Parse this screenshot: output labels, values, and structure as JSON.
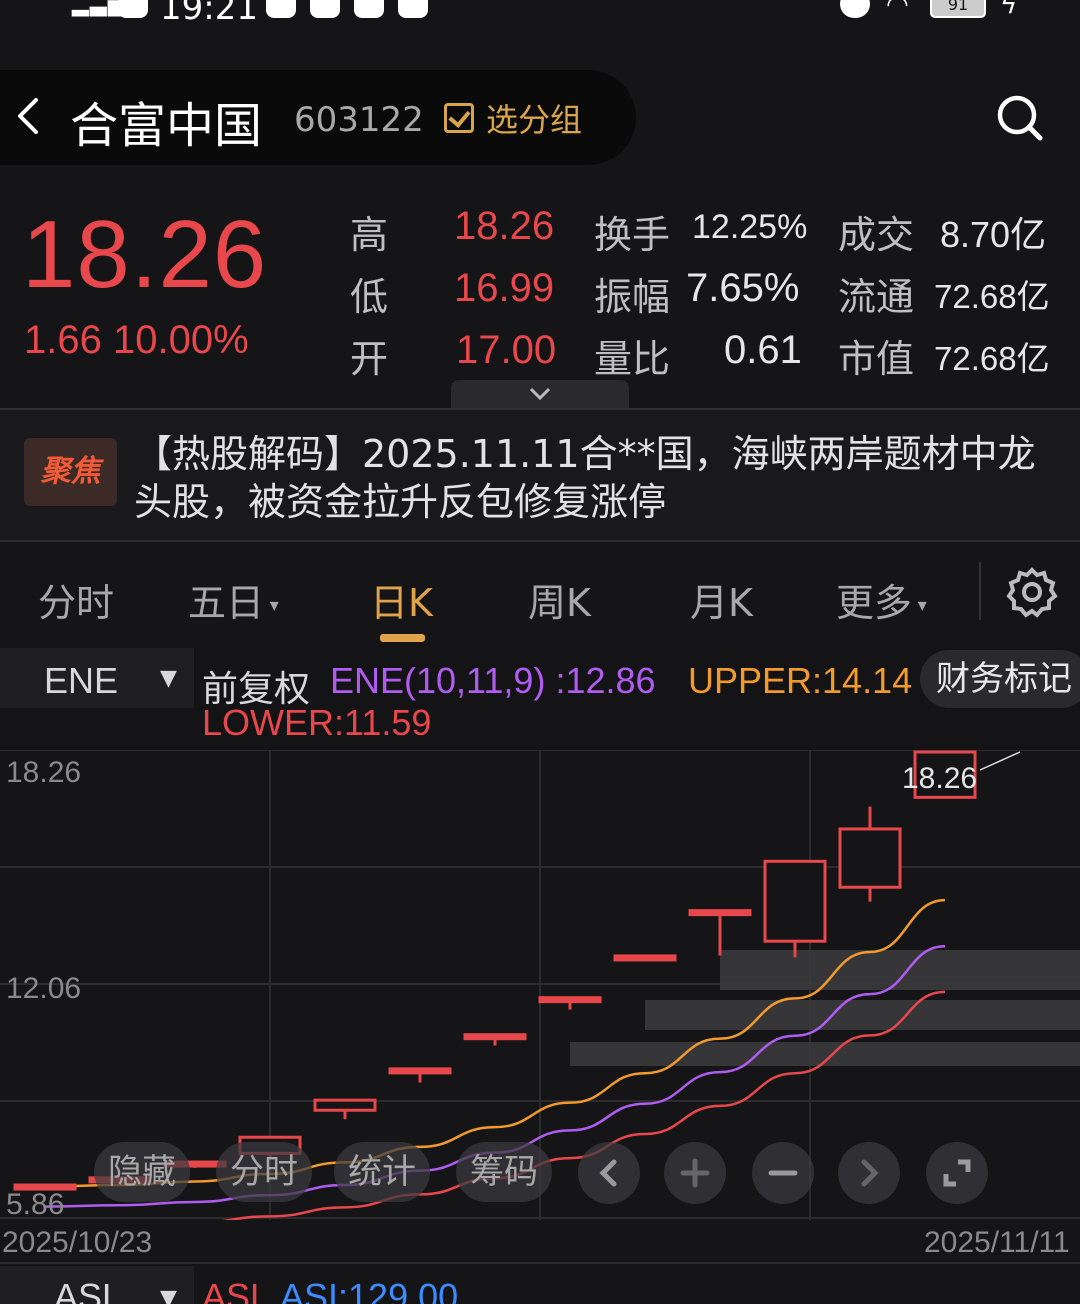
{
  "status_bar": {
    "time": "19:21",
    "battery": "91"
  },
  "header": {
    "title": "合富中国",
    "code": "603122",
    "group_button": "选分组"
  },
  "quote": {
    "price": "18.26",
    "change": "1.66 10.00%",
    "rows": [
      {
        "l1": "高",
        "v1": "18.26",
        "l2": "换手",
        "v2": "12.25%",
        "l3": "成交",
        "v3": "8.70亿"
      },
      {
        "l1": "低",
        "v1": "16.99",
        "l2": "振幅",
        "v2": "7.65%",
        "l3": "流通",
        "v3": "72.68亿"
      },
      {
        "l1": "开",
        "v1": "17.00",
        "l2": "量比",
        "v2": "0.61",
        "l3": "市值",
        "v3": "72.68亿"
      }
    ]
  },
  "news": {
    "badge": "聚焦",
    "text": "【热股解码】2025.11.11合**国，海峡两岸题材中龙头股，被资金拉升反包修复涨停"
  },
  "tabs": [
    "分时",
    "五日",
    "日K",
    "周K",
    "月K",
    "更多"
  ],
  "active_tab": "日K",
  "indicator": {
    "selector": "ENE",
    "fuquan": "前复权",
    "ene": "ENE(10,11,9)  :12.86",
    "upper": "UPPER:14.14",
    "lower": "LOWER:11.59",
    "finance_button": "财务标记"
  },
  "chart_data": {
    "type": "candlestick",
    "y_ticks": [
      "18.26",
      "12.06",
      "5.86"
    ],
    "x_labels": [
      "2025/10/23",
      "2025/11/11"
    ],
    "high_label": "18.26",
    "candles": [
      {
        "open": 6.2,
        "close": 6.22,
        "high": 6.24,
        "low": 6.18
      },
      {
        "open": 6.4,
        "close": 6.42,
        "high": 6.44,
        "low": 6.36
      },
      {
        "open": 6.84,
        "close": 6.86,
        "high": 6.9,
        "low": 6.7
      },
      {
        "open": 7.1,
        "close": 7.55,
        "high": 7.55,
        "low": 6.95
      },
      {
        "open": 8.3,
        "close": 8.58,
        "high": 8.58,
        "low": 8.05
      },
      {
        "open": 9.43,
        "close": 9.45,
        "high": 9.45,
        "low": 9.07
      },
      {
        "open": 10.38,
        "close": 10.4,
        "high": 10.4,
        "low": 10.1
      },
      {
        "open": 11.41,
        "close": 11.43,
        "high": 11.43,
        "low": 11.1
      },
      {
        "open": 12.57,
        "close": 12.59,
        "high": 12.59,
        "low": 12.59
      },
      {
        "open": 13.83,
        "close": 13.85,
        "high": 13.85,
        "low": 12.6
      },
      {
        "open": 15.22,
        "close": 13.0,
        "high": 15.22,
        "low": 12.55
      },
      {
        "open": 16.12,
        "close": 14.5,
        "high": 16.74,
        "low": 14.1
      },
      {
        "open": 18.26,
        "close": 17.0,
        "high": 18.26,
        "low": 16.99
      }
    ],
    "series": [
      {
        "name": "UPPER",
        "color": "#f29a2e",
        "values": [
          6.18,
          6.22,
          6.32,
          6.53,
          6.85,
          7.28,
          7.83,
          8.51,
          9.33,
          10.29,
          11.41,
          12.7,
          14.14
        ]
      },
      {
        "name": "ENE",
        "color": "#b05cf0",
        "values": [
          5.62,
          5.66,
          5.75,
          5.94,
          6.22,
          6.62,
          7.12,
          7.74,
          8.48,
          9.36,
          10.37,
          11.53,
          12.86
        ]
      },
      {
        "name": "LOWER",
        "color": "#e8474b",
        "values": [
          5.06,
          5.09,
          5.17,
          5.35,
          5.6,
          5.96,
          6.41,
          6.97,
          7.64,
          8.42,
          9.33,
          10.38,
          11.59
        ]
      }
    ],
    "ylim": [
      5.86,
      18.26
    ]
  },
  "overlay_controls": [
    "隐藏",
    "分时",
    "统计",
    "筹码"
  ],
  "bottom": {
    "selector": "ASL",
    "asl_label": "ASL",
    "asl_value": "ASI:129.00"
  }
}
